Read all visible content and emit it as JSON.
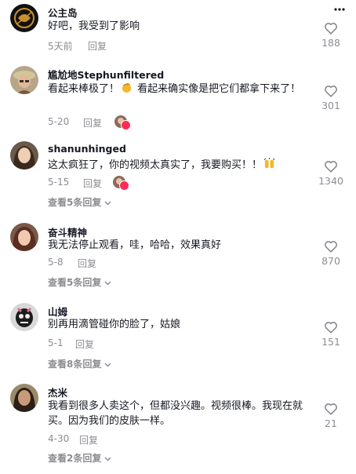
{
  "comments": [
    {
      "username": "公主岛",
      "text": "好吧，我受到了影响",
      "time": "5天前",
      "reply_label": "回复",
      "likes": "188",
      "view_replies": null
    },
    {
      "username": "尴尬地Stephunfiltered",
      "text_before": "看起来棒极了！",
      "text_after": "看起来确实像是把它们都拿下来了！",
      "emoji": "clapping-hands-icon",
      "time": "5-20",
      "reply_label": "回复",
      "likes": "301",
      "view_replies": null
    },
    {
      "username": "shanunhinged",
      "text_before": "这太疯狂了，你的视频太真实了，我要购买！！",
      "emoji": "raised-hands-icon",
      "time": "5-15",
      "reply_label": "回复",
      "likes": "1340",
      "view_replies": "查看5条回复"
    },
    {
      "username": "奋斗精神",
      "text": "我无法停止观看，哇，哈哈，效果真好",
      "time": "5-8",
      "reply_label": "回复",
      "likes": "870",
      "view_replies": "查看5条回复"
    },
    {
      "username": "山姆",
      "text": "别再用滴管碰你的脸了，姑娘",
      "time": "5-1",
      "reply_label": "回复",
      "likes": "151",
      "view_replies": "查看8条回复"
    },
    {
      "username": "杰米",
      "text": "我看到很多人卖这个，但都没兴趣。视频很棒。我现在就买。因为我们的皮肤一样。",
      "time": "4-30",
      "reply_label": "回复",
      "likes": "21",
      "view_replies": "查看2条回复"
    }
  ],
  "colors": {
    "text": "#161823",
    "muted": "rgba(22,24,35,0.5)",
    "heart_badge": "#fe2c55"
  }
}
